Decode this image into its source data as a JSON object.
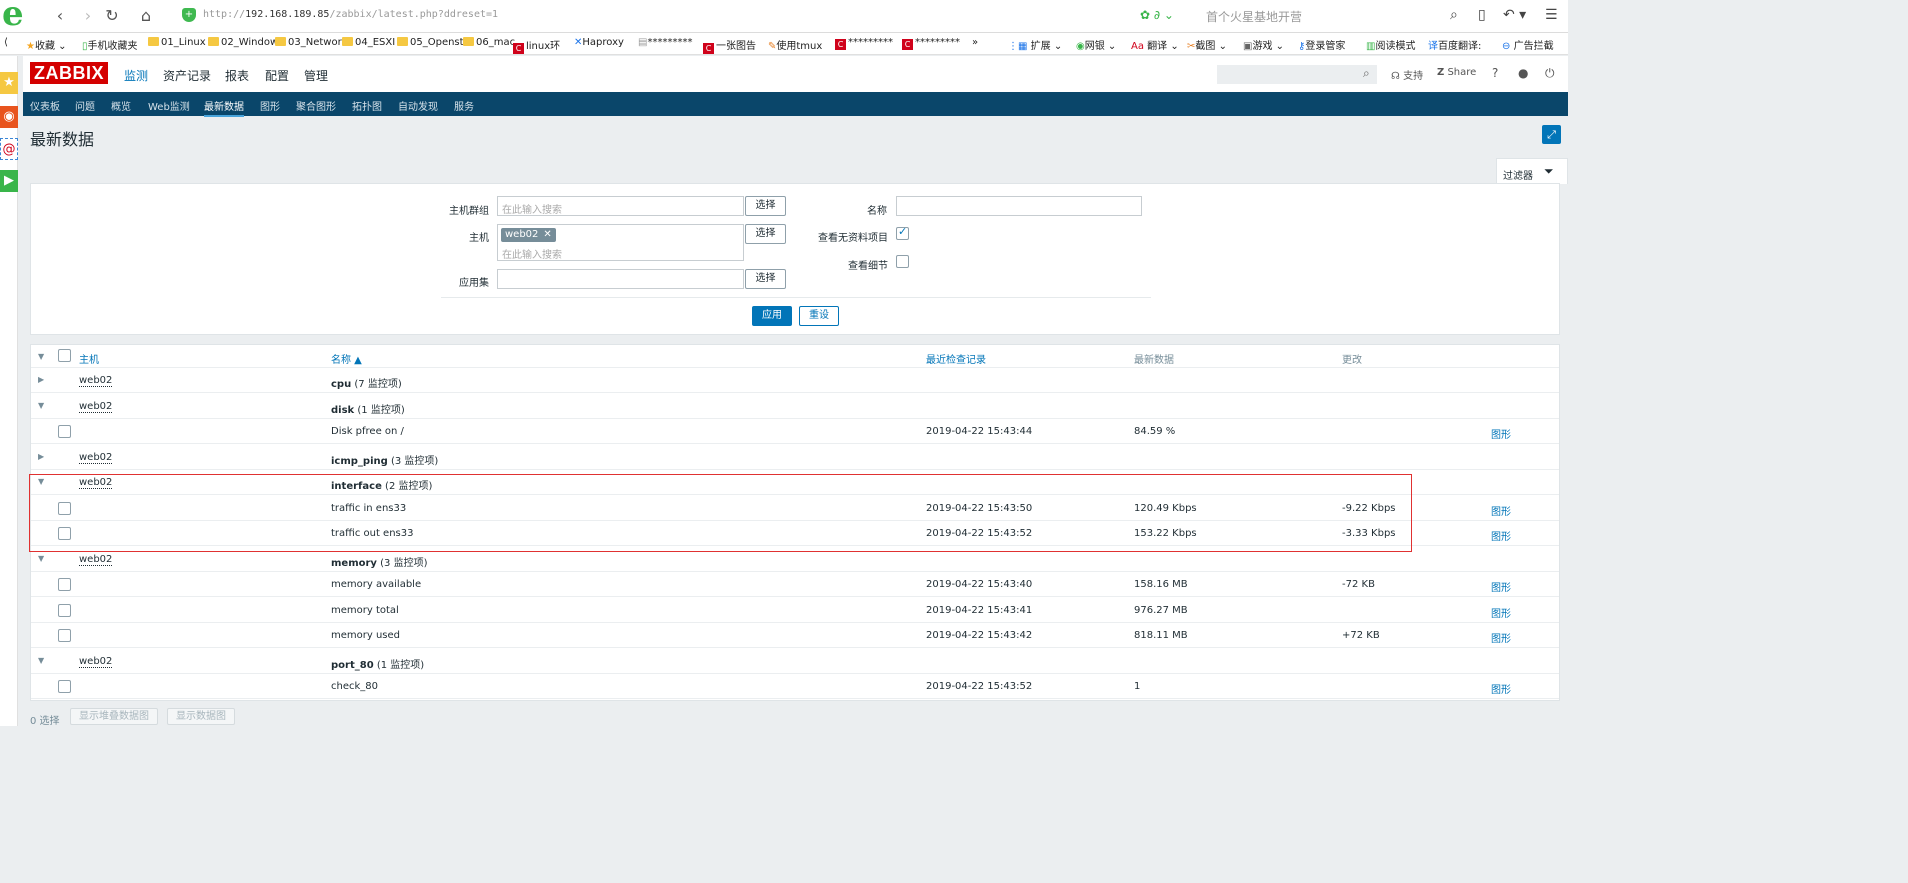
{
  "browser": {
    "url_prefix": "http://",
    "url_host": "192.168.189.85",
    "url_path": "/zabbix/latest.php?ddreset=1",
    "search_hint": "首个火星基地开营"
  },
  "bookmarks": [
    {
      "label": "收藏",
      "icon": "star-icon"
    },
    {
      "label": "手机收藏夹",
      "icon": "phone-icon"
    },
    {
      "label": "01_Linux",
      "icon": "folder-icon"
    },
    {
      "label": "02_Window",
      "icon": "folder-icon"
    },
    {
      "label": "03_Networ",
      "icon": "folder-icon"
    },
    {
      "label": "04_ESXI",
      "icon": "folder-icon"
    },
    {
      "label": "05_Openst",
      "icon": "folder-icon"
    },
    {
      "label": "06_mac",
      "icon": "folder-icon"
    },
    {
      "label": "linux环",
      "icon": "red-c-icon"
    },
    {
      "label": "Haproxy",
      "icon": "x-icon"
    },
    {
      "label": "*********",
      "icon": "doc-icon"
    },
    {
      "label": "一张图告",
      "icon": "red-c-icon"
    },
    {
      "label": "使用tmux",
      "icon": "pen-icon"
    },
    {
      "label": "*********",
      "icon": "red-c-icon"
    },
    {
      "label": "*********",
      "icon": "red-c-icon"
    },
    {
      "label": "»",
      "icon": ""
    }
  ],
  "toolbar_right": {
    "extensions": "扩展",
    "netbank": "网银",
    "translate": "翻译",
    "screenshot": "截图",
    "games": "游戏",
    "login_manager": "登录管家",
    "reader": "阅读模式",
    "baidu_translate": "百度翻译:",
    "adblock": "广告拦截"
  },
  "zabbix": {
    "logo": "ZABBIX",
    "main_menu": [
      "监测",
      "资产记录",
      "报表",
      "配置",
      "管理"
    ],
    "main_menu_active": 0,
    "support": "支持",
    "share": "Share",
    "help": "?",
    "sub_menu": [
      "仪表板",
      "问题",
      "概览",
      "Web监测",
      "最新数据",
      "图形",
      "聚合图形",
      "拓扑图",
      "自动发现",
      "服务"
    ],
    "sub_menu_active": 4,
    "page_title": "最新数据"
  },
  "filter": {
    "tab_label": "过滤器",
    "host_group_label": "主机群组",
    "host_group_placeholder": "在此输入搜索",
    "host_label": "主机",
    "host_tag": "web02",
    "host_placeholder": "在此输入搜索",
    "app_label": "应用集",
    "select_label": "选择",
    "name_label": "名称",
    "name_value": "",
    "show_no_data_label": "查看无资料项目",
    "show_no_data_checked": true,
    "show_details_label": "查看细节",
    "show_details_checked": false,
    "apply_label": "应用",
    "reset_label": "重设"
  },
  "table": {
    "headers": {
      "host": "主机",
      "name": "名称 ▲",
      "last_check": "最近检查记录",
      "last_value": "最新数据",
      "change": "更改"
    },
    "rows": [
      {
        "type": "app",
        "expanded": false,
        "host": "web02",
        "app": "cpu",
        "count": "(7 监控项)"
      },
      {
        "type": "app",
        "expanded": true,
        "host": "web02",
        "app": "disk",
        "count": "(1 监控项)"
      },
      {
        "type": "item",
        "name": "Disk pfree on /",
        "last_check": "2019-04-22 15:43:44",
        "last_value": "84.59 %",
        "change": "",
        "link": "图形"
      },
      {
        "type": "app",
        "expanded": false,
        "host": "web02",
        "app": "icmp_ping",
        "count": "(3 监控项)"
      },
      {
        "type": "app",
        "expanded": true,
        "host": "web02",
        "app": "interface",
        "count": "(2 监控项)"
      },
      {
        "type": "item",
        "name": "traffic in ens33",
        "last_check": "2019-04-22 15:43:50",
        "last_value": "120.49 Kbps",
        "change": "-9.22 Kbps",
        "link": "图形"
      },
      {
        "type": "item",
        "name": "traffic out ens33",
        "last_check": "2019-04-22 15:43:52",
        "last_value": "153.22 Kbps",
        "change": "-3.33 Kbps",
        "link": "图形"
      },
      {
        "type": "app",
        "expanded": true,
        "host": "web02",
        "app": "memory",
        "count": "(3 监控项)"
      },
      {
        "type": "item",
        "name": "memory available",
        "last_check": "2019-04-22 15:43:40",
        "last_value": "158.16 MB",
        "change": "-72 KB",
        "link": "图形"
      },
      {
        "type": "item",
        "name": "memory total",
        "last_check": "2019-04-22 15:43:41",
        "last_value": "976.27 MB",
        "change": "",
        "link": "图形"
      },
      {
        "type": "item",
        "name": "memory used",
        "last_check": "2019-04-22 15:43:42",
        "last_value": "818.11 MB",
        "change": "+72 KB",
        "link": "图形"
      },
      {
        "type": "app",
        "expanded": true,
        "host": "web02",
        "app": "port_80",
        "count": "(1 监控项)"
      },
      {
        "type": "item",
        "name": "check_80",
        "last_check": "2019-04-22 15:43:52",
        "last_value": "1",
        "change": "",
        "link": "图形"
      }
    ]
  },
  "footer": {
    "selected": "0 选择",
    "stacked_graph": "显示堆叠数据图",
    "show_graph": "显示数据图"
  }
}
